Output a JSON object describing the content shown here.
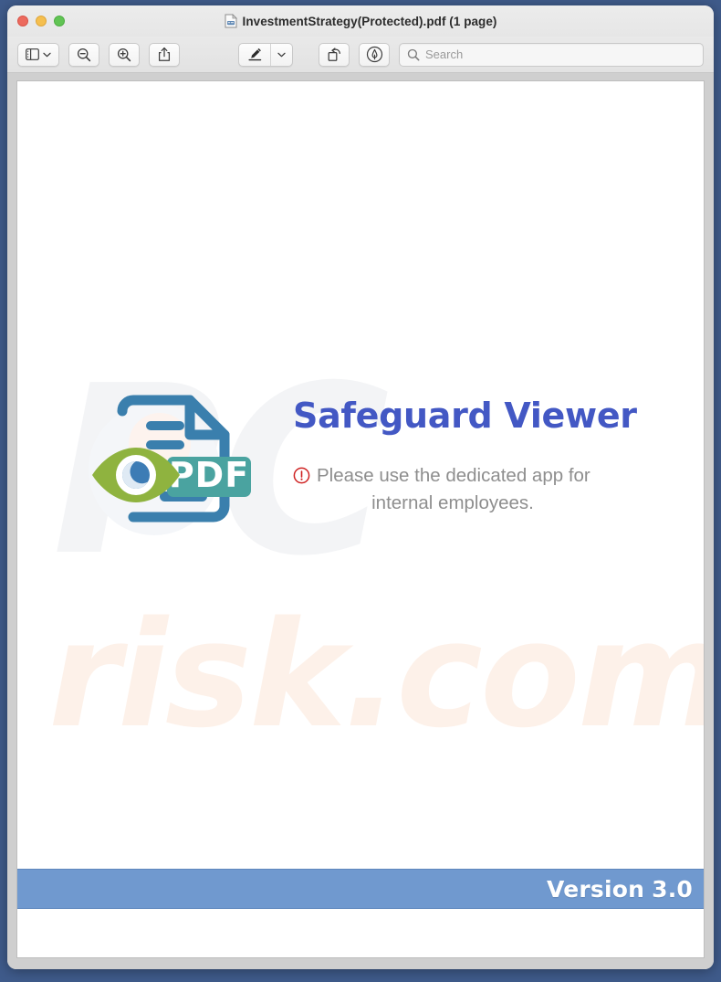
{
  "window": {
    "title": "InvestmentStrategy(Protected).pdf (1 page)",
    "title_icon": "pdf-document-icon",
    "controls": {
      "close": "close-button",
      "minimize": "minimize-button",
      "maximize": "maximize-button"
    }
  },
  "toolbar": {
    "sidebar_button": "sidebar-view-button",
    "sidebar_menu": "sidebar-dropdown-chevron",
    "zoom_out_button": "zoom-out-button",
    "zoom_in_button": "zoom-in-button",
    "share_button": "share-button",
    "markup_button": "markup-pen-button",
    "markup_menu": "markup-dropdown-chevron",
    "rotate_button": "rotate-button",
    "annotate_button": "annotate-button",
    "search": {
      "placeholder": "Search",
      "value": ""
    }
  },
  "document": {
    "watermarks": {
      "primary": "PC",
      "secondary": "risk.com"
    },
    "logo": {
      "alt": "safeguard-viewer-pdf-logo",
      "badge_text": "PDF",
      "colors": {
        "document_outline": "#3a7fad",
        "eye_iris": "#8fb33f",
        "eye_pupil": "#3d7cb5",
        "pdf_badge": "#4aa3a0"
      }
    },
    "brand_title": "Safeguard Viewer",
    "notice": {
      "icon": "warning-exclamation-icon",
      "line1": "Please use the dedicated app for",
      "line2": "internal employees."
    },
    "version_banner": {
      "label": "Version",
      "number": "3.0",
      "background_color": "#7099cf"
    }
  }
}
